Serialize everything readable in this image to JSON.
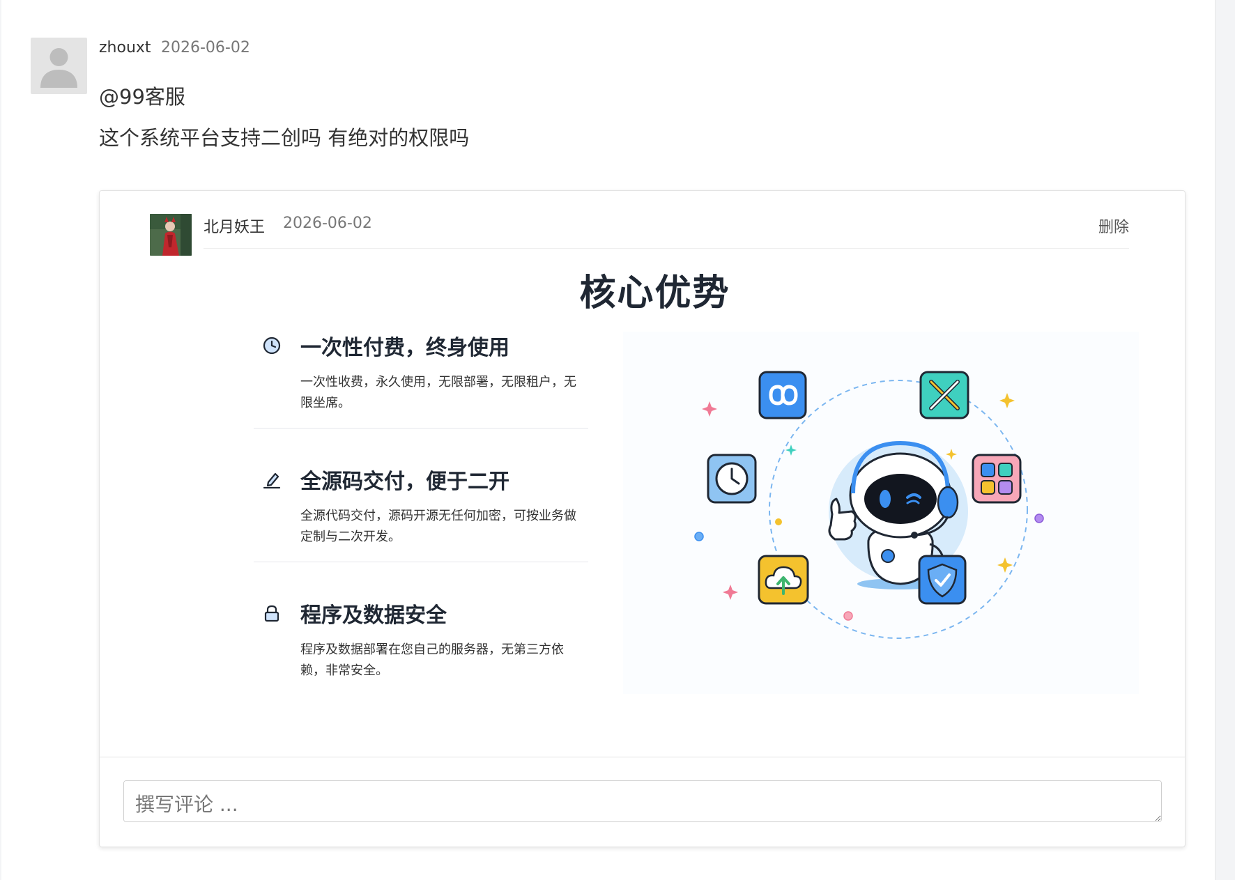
{
  "topic": {
    "author": "zhouxt",
    "date": "2026-06-02",
    "mention": "@99客服",
    "body": "这个系统平台支持二创吗 有绝对的权限吗"
  },
  "reply": {
    "author": "北月妖王",
    "date": "2026-06-02",
    "delete_label": "删除",
    "poster": {
      "title": "核心优势",
      "features": [
        {
          "icon": "clock-icon",
          "title": "一次性付费，终身使用",
          "desc": "一次性收费，永久使用，无限部署，无限租户，无限坐席。"
        },
        {
          "icon": "pen-icon",
          "title": "全源码交付，便于二开",
          "desc": "全源代码交付，源码开源无任何加密，可按业务做定制与二次开发。"
        },
        {
          "icon": "lock-icon",
          "title": "程序及数据安全",
          "desc": "程序及数据部署在您自己的服务器，无第三方依赖，非常安全。"
        }
      ]
    }
  },
  "comment": {
    "placeholder": "撰写评论 ..."
  },
  "colors": {
    "accent_blue": "#3b8ff0",
    "title_dark": "#1f2733"
  }
}
